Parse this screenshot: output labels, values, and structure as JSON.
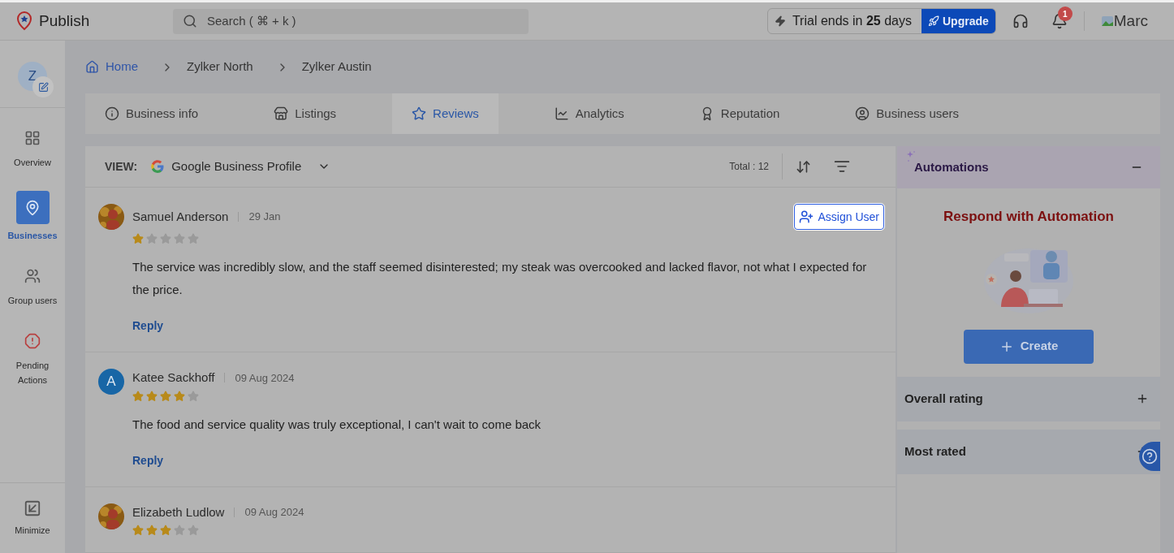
{
  "app": {
    "name": "Publish"
  },
  "search": {
    "placeholder": "Search ( ⌘ + k )"
  },
  "trial": {
    "text": "Trial ends in **25** days",
    "button": "Upgrade"
  },
  "notifications": {
    "count": "1"
  },
  "user": {
    "name": "Marc"
  },
  "sidebar": {
    "avatar_letter": "Z",
    "items": [
      {
        "label": "Overview",
        "kind": "overview",
        "selected": false
      },
      {
        "label": "Businesses",
        "kind": "businesses",
        "selected": true
      },
      {
        "label": "Group users",
        "kind": "group",
        "selected": false
      },
      {
        "label": "Pending Actions",
        "kind": "pending",
        "selected": false
      }
    ],
    "bottom": {
      "label": "Minimize"
    }
  },
  "breadcrumb": [
    "Home",
    "Zylker North",
    "Zylker Austin"
  ],
  "tabs": [
    {
      "label": "Business info",
      "kind": "info",
      "selected": false
    },
    {
      "label": "Listings",
      "kind": "store",
      "selected": false
    },
    {
      "label": "Reviews",
      "kind": "star",
      "selected": true
    },
    {
      "label": "Analytics",
      "kind": "chart",
      "selected": false
    },
    {
      "label": "Reputation",
      "kind": "award",
      "selected": false
    },
    {
      "label": "Business users",
      "kind": "user",
      "selected": false
    }
  ],
  "view": {
    "label": "VIEW:",
    "source": "Google Business Profile",
    "total": "Total : 12"
  },
  "reviews": [
    {
      "name": "Samuel Anderson",
      "date": "29 Jan",
      "stars": 1,
      "text": "The service was incredibly slow, and the staff seemed disinterested; my steak was overcooked and lacked flavor, not what I expected for the price.",
      "reply": "Reply",
      "assign": "Assign User"
    },
    {
      "name": "Katee Sackhoff",
      "date": "09 Aug 2024",
      "kind": "letter",
      "letter": "A",
      "stars": 4,
      "text": "The food and service quality was truly exceptional, I can't wait to come back",
      "reply": "Reply"
    },
    {
      "name": "Elizabeth Ludlow",
      "date": "09 Aug 2024",
      "stars": 3
    }
  ],
  "automations": {
    "title": "Automations",
    "heading": "Respond with Automation",
    "button": "Create"
  },
  "sections": [
    {
      "title": "Overall rating",
      "expanded": false
    },
    {
      "title": "Most rated",
      "expanded": false
    }
  ]
}
